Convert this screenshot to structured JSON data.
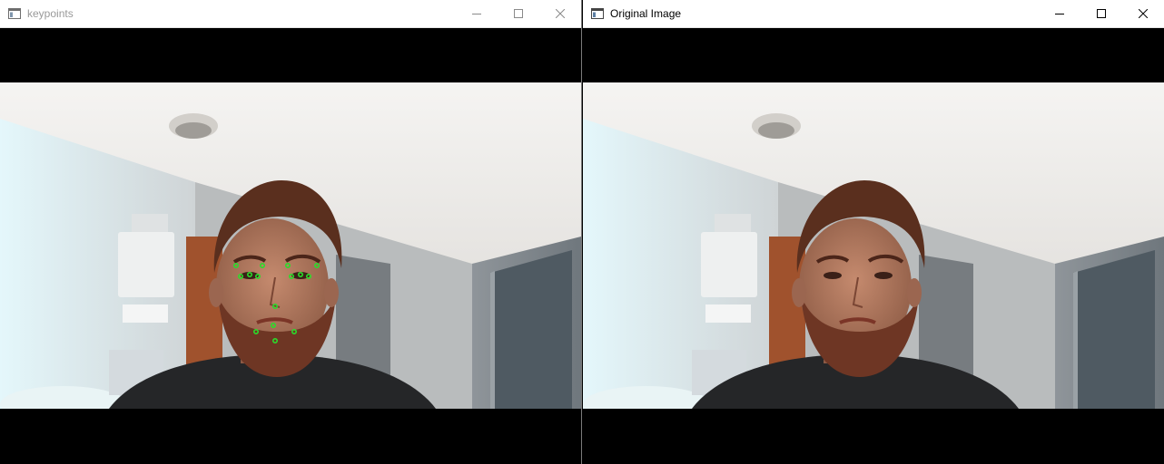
{
  "windows": {
    "left": {
      "title": "keypoints",
      "controls": [
        "minimize-icon",
        "maximize-icon",
        "close-icon"
      ],
      "keypoint_color": "#2bdc2b"
    },
    "right": {
      "title": "Original Image",
      "controls": [
        "minimize-icon",
        "maximize-icon",
        "close-icon"
      ]
    }
  }
}
